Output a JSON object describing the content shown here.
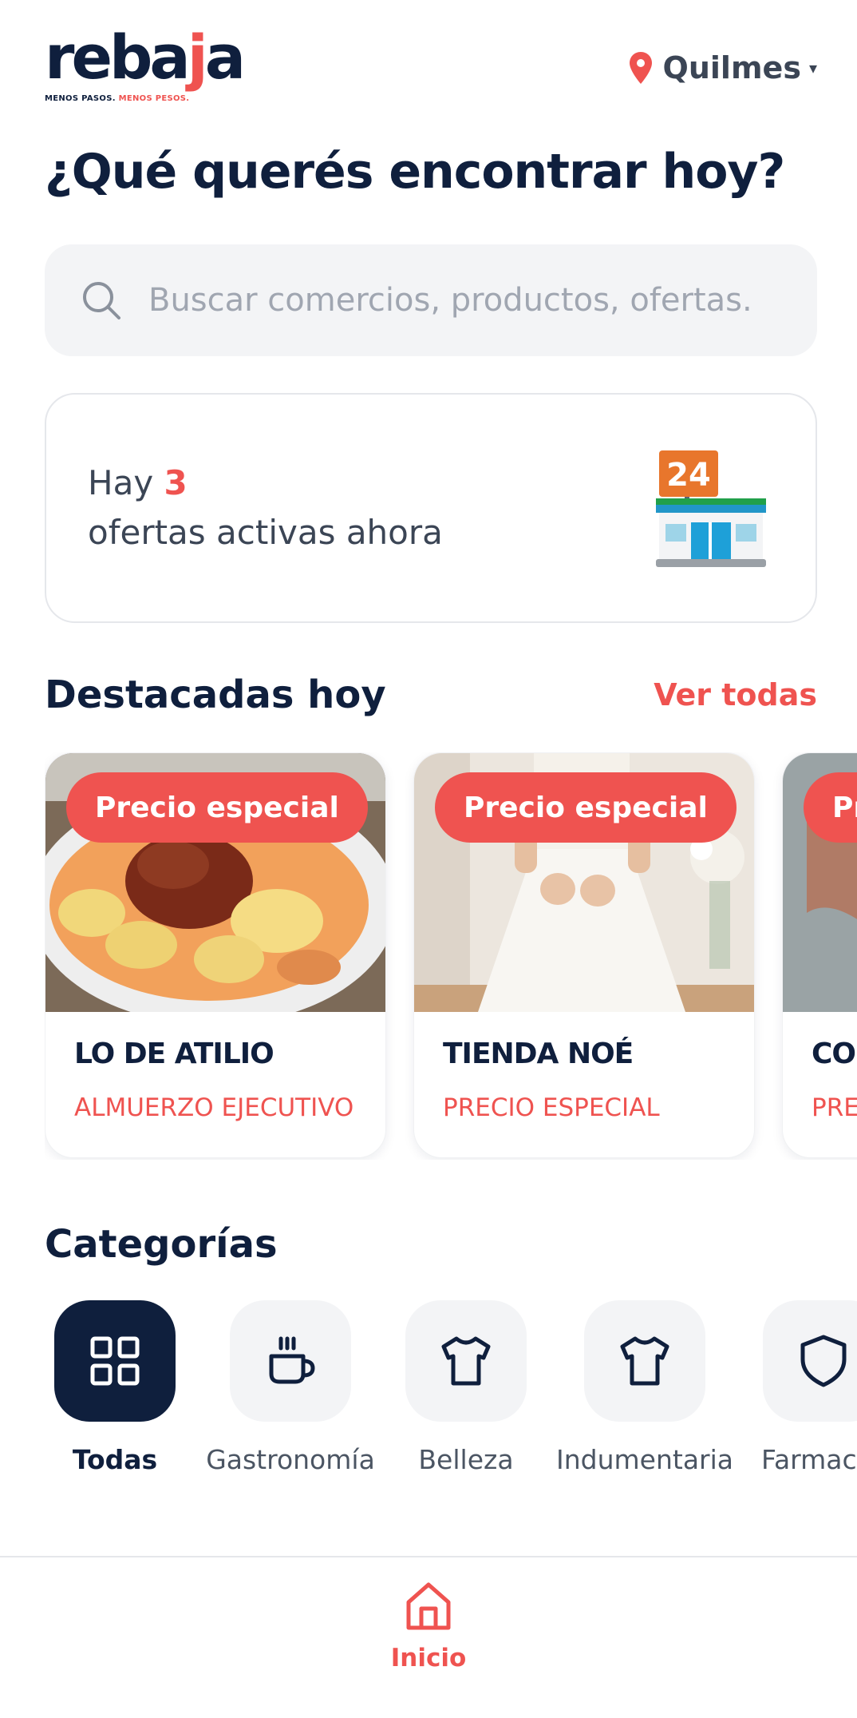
{
  "brand": {
    "name_part1": "reba",
    "name_part2": "j",
    "name_part3": "a",
    "tagline_part1": "MENOS PASOS.",
    "tagline_part2": "MENOS PESOS."
  },
  "header": {
    "location": "Quilmes",
    "location_caret": "▾"
  },
  "hero": {
    "title": "¿Qué querés encontrar hoy?"
  },
  "search": {
    "placeholder": "Buscar comercios, productos, ofertas."
  },
  "offers": {
    "prefix": "Hay",
    "count": "3",
    "suffix": "ofertas activas ahora",
    "store_sign": "24"
  },
  "featured": {
    "title": "Destacadas hoy",
    "see_all": "Ver todas",
    "items": [
      {
        "badge": "Precio especial",
        "name": "LO DE ATILIO",
        "subtitle": "ALMUERZO EJECUTIVO"
      },
      {
        "badge": "Precio especial",
        "name": "TIENDA NOÉ",
        "subtitle": "PRECIO ESPECIAL"
      },
      {
        "badge": "Pr",
        "name": "CO",
        "subtitle": "PRE"
      }
    ]
  },
  "categories": {
    "title": "Categorías",
    "items": [
      {
        "label": "Todas",
        "icon": "grid-icon",
        "active": true
      },
      {
        "label": "Gastronomía",
        "icon": "coffee-cup-icon"
      },
      {
        "label": "Belleza",
        "icon": "shirt-icon"
      },
      {
        "label": "Indumentaria",
        "icon": "shirt-icon"
      },
      {
        "label": "Farmac",
        "icon": "shield-icon"
      }
    ]
  },
  "nav": {
    "home_label": "Inicio"
  },
  "colors": {
    "brand_navy": "#0f1f3d",
    "accent_red": "#ef5350",
    "surface": "#f3f4f6"
  }
}
